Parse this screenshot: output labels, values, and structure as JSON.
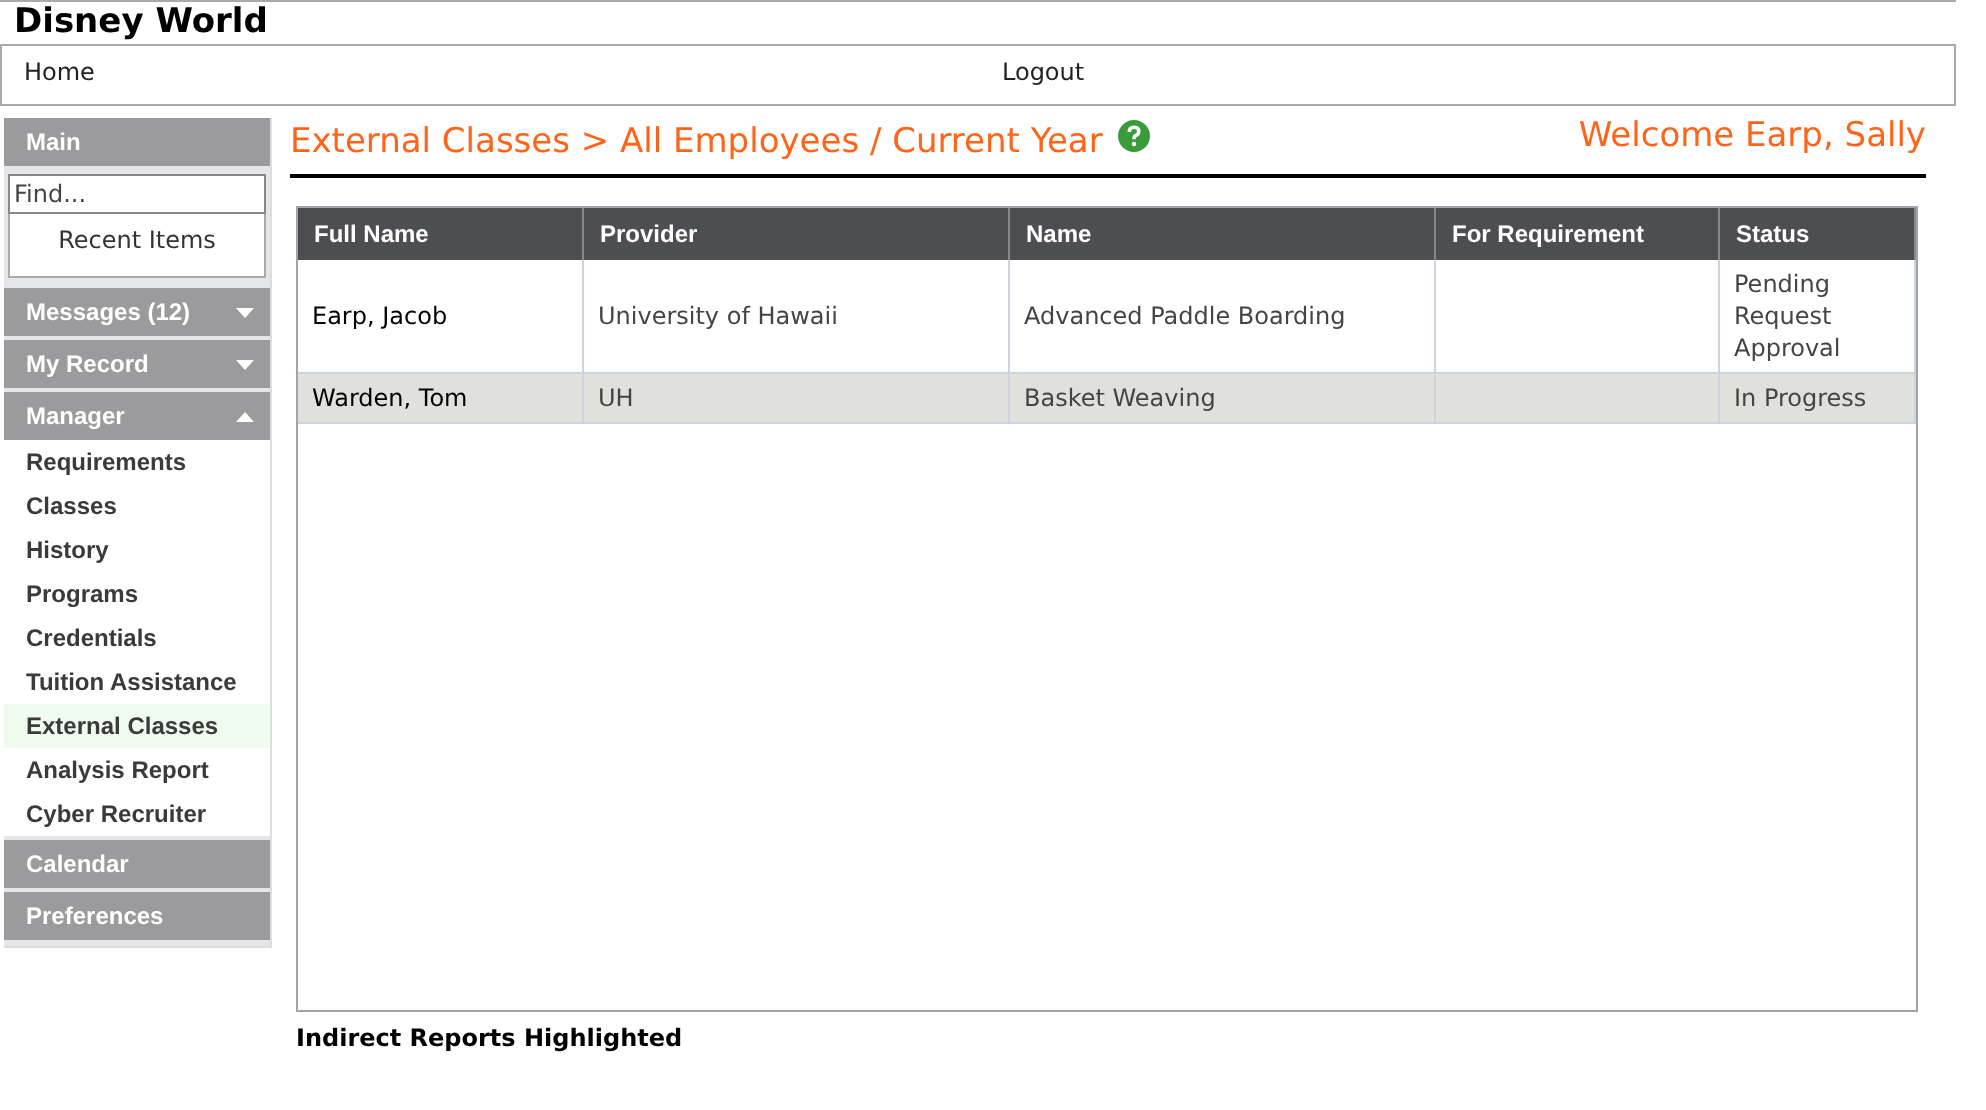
{
  "site_title": "Disney World",
  "nav": [
    "Home",
    "Logout"
  ],
  "sidebar": {
    "sections": [
      {
        "label": "Main",
        "search": {
          "placeholder": "Find..."
        },
        "link": "Recent Items"
      },
      {
        "label": "Messages (12)",
        "expanded": false
      },
      {
        "label": "My Record",
        "expanded": false
      },
      {
        "label": "Manager",
        "expanded": true,
        "items": [
          {
            "label": "Requirements",
            "selected": false
          },
          {
            "label": "Classes",
            "selected": false
          },
          {
            "label": "History",
            "selected": false
          },
          {
            "label": "Programs",
            "selected": false
          },
          {
            "label": "Credentials",
            "selected": false
          },
          {
            "label": "Tuition Assistance",
            "selected": false
          },
          {
            "label": "External Classes",
            "selected": true
          },
          {
            "label": "Analysis Report",
            "selected": false
          },
          {
            "label": "Cyber Recruiter",
            "selected": false
          }
        ]
      },
      {
        "label": "Calendar"
      },
      {
        "label": "Preferences"
      }
    ]
  },
  "breadcrumb": "External Classes > All Employees / Current Year",
  "welcome": "Welcome Earp, Sally",
  "table": {
    "columns": [
      "Full Name",
      "Provider",
      "Name",
      "For Requirement",
      "Status"
    ],
    "rows": [
      {
        "highlighted": false,
        "cells": [
          "Earp, Jacob",
          "University of Hawaii",
          "Advanced Paddle Boarding",
          "",
          "Pending Request Approval"
        ]
      },
      {
        "highlighted": true,
        "cells": [
          "Warden, Tom",
          "UH",
          "Basket Weaving",
          "",
          "In Progress"
        ]
      }
    ]
  },
  "footer_note": "Indirect Reports Highlighted"
}
